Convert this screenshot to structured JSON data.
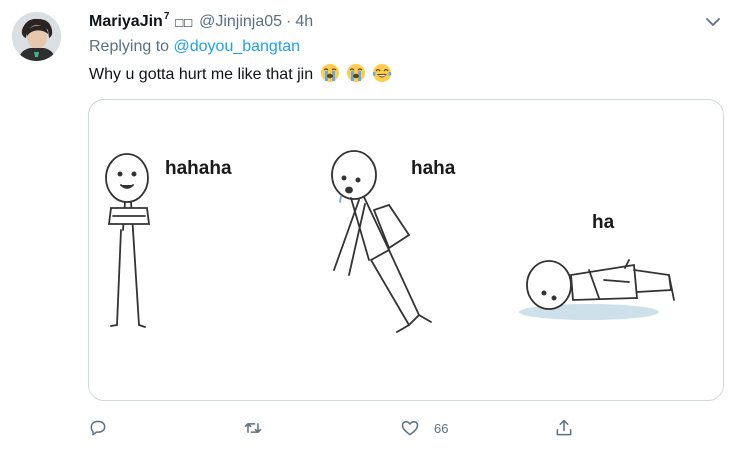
{
  "tweet": {
    "display_name": "MariyaJin",
    "display_name_sup": "7",
    "display_name_emoji": "□□",
    "handle": "@Jinjinja05",
    "separator": "·",
    "time": "4h",
    "replying_to_label": "Replying to",
    "replying_to_user": "@doyou_bangtan",
    "text": "Why u gotta hurt me like that jin",
    "text_emojis": [
      "loudly-crying-face",
      "loudly-crying-face",
      "tears-of-joy-face"
    ]
  },
  "media": {
    "labels": [
      "hahaha",
      "haha",
      "ha"
    ]
  },
  "actions": {
    "reply_icon": "reply-icon",
    "retweet_icon": "retweet-icon",
    "like_icon": "heart-icon",
    "like_count": "66",
    "share_icon": "share-icon"
  },
  "colors": {
    "link": "#1da1f2",
    "secondary_text": "#5b7083",
    "border": "#cfd9de"
  }
}
